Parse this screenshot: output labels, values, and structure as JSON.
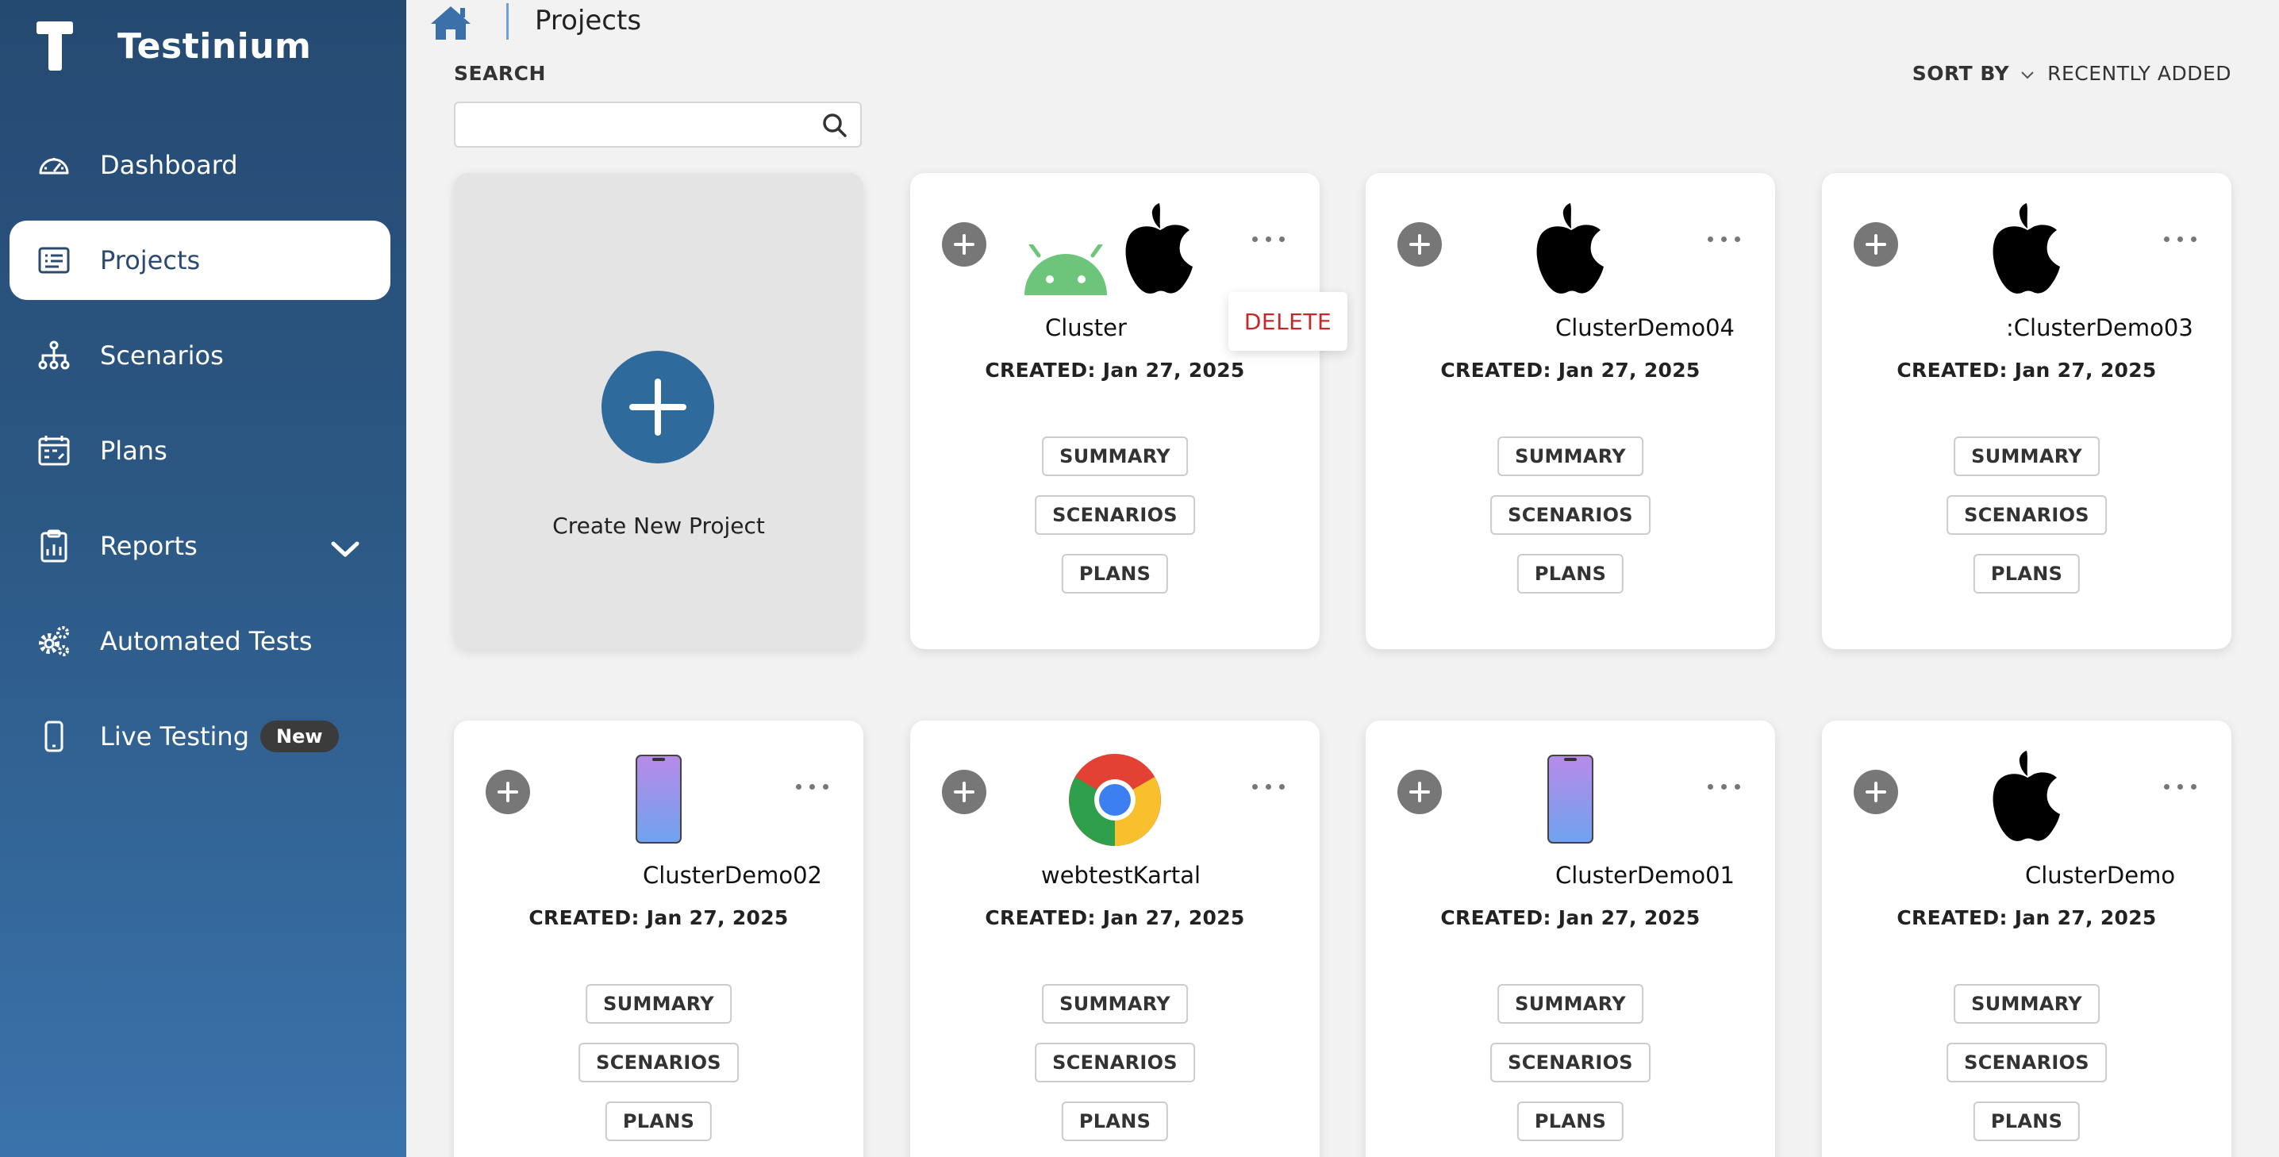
{
  "app": {
    "name": "Testinium"
  },
  "sidebar": {
    "items": [
      {
        "label": "Dashboard",
        "icon": "dashboard-icon"
      },
      {
        "label": "Projects",
        "icon": "projects-icon",
        "active": true
      },
      {
        "label": "Scenarios",
        "icon": "scenarios-icon"
      },
      {
        "label": "Plans",
        "icon": "plans-icon"
      },
      {
        "label": "Reports",
        "icon": "reports-icon",
        "expandable": true
      },
      {
        "label": "Automated Tests",
        "icon": "gears-icon"
      },
      {
        "label": "Live Testing",
        "icon": "phone-icon",
        "badge": "New"
      }
    ]
  },
  "header": {
    "title": "Projects",
    "home_icon": "home-icon"
  },
  "search": {
    "label": "SEARCH",
    "value": "",
    "placeholder": ""
  },
  "sort": {
    "label": "SORT BY",
    "value": "RECENTLY ADDED"
  },
  "create_card": {
    "label": "Create New Project"
  },
  "context_menu": {
    "delete_label": "DELETE"
  },
  "card_buttons": {
    "summary": "SUMMARY",
    "scenarios": "SCENARIOS",
    "plans": "PLANS"
  },
  "projects": [
    {
      "name": "Cluster",
      "created": "CREATED: Jan 27, 2025",
      "platforms": [
        "android-icon",
        "apple-icon"
      ]
    },
    {
      "name": "ClusterDemo04",
      "created": "CREATED: Jan 27, 2025",
      "platforms": [
        "apple-icon"
      ]
    },
    {
      "name": ":ClusterDemo03",
      "created": "CREATED: Jan 27, 2025",
      "platforms": [
        "apple-icon"
      ]
    },
    {
      "name": "ClusterDemo02",
      "created": "CREATED: Jan 27, 2025",
      "platforms": [
        "phone-device-icon"
      ]
    },
    {
      "name": "webtestKartal",
      "created": "CREATED: Jan 27, 2025",
      "platforms": [
        "chrome-icon"
      ]
    },
    {
      "name": "ClusterDemo01",
      "created": "CREATED: Jan 27, 2025",
      "platforms": [
        "phone-device-icon"
      ]
    },
    {
      "name": "ClusterDemo",
      "created": "CREATED: Jan 27, 2025",
      "platforms": [
        "apple-icon"
      ]
    }
  ],
  "colors": {
    "sidebar_top": "#254a72",
    "sidebar_bottom": "#3a73ab",
    "accent": "#2e6a9c",
    "delete": "#c62828"
  }
}
